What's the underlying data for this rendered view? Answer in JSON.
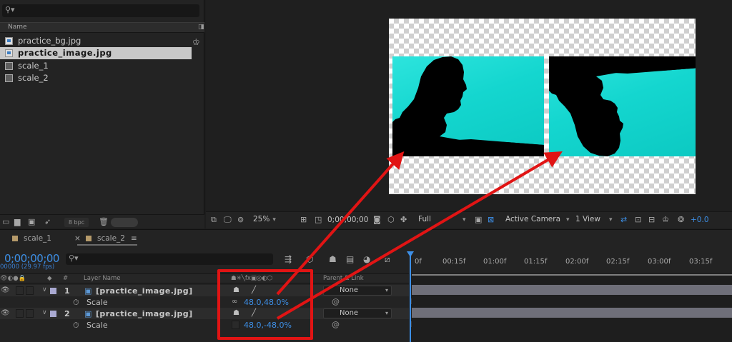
{
  "project": {
    "search_icon": "search-icon",
    "column_name": "Name",
    "items": [
      {
        "name": "practice_bg.jpg",
        "type": "image",
        "selected": false
      },
      {
        "name": "practice_image.jpg",
        "type": "image",
        "selected": true
      },
      {
        "name": "scale_1",
        "type": "composition",
        "selected": false
      },
      {
        "name": "scale_2",
        "type": "composition",
        "selected": false
      }
    ],
    "bit_depth": "8 bpc"
  },
  "viewer_toolbar": {
    "zoom": "25%",
    "timecode": "0;00;00;00",
    "resolution": "Full",
    "camera": "Active Camera",
    "views": "1 View",
    "exposure": "+0.0"
  },
  "timeline": {
    "tabs": [
      {
        "label": "scale_1",
        "active": false,
        "closable": false
      },
      {
        "label": "scale_2",
        "active": true,
        "closable": true
      }
    ],
    "current_time": "0;00;00;00",
    "fps": "00000 (29.97 fps)",
    "columns": {
      "number": "#",
      "layer_name": "Layer Name",
      "parent_link": "Parent & Link"
    },
    "layers": [
      {
        "index": "1",
        "name": "[practice_image.jpg]",
        "parent": "None",
        "property": "Scale",
        "value": "48.0,48.0%",
        "constrained": true
      },
      {
        "index": "2",
        "name": "[practice_image.jpg]",
        "parent": "None",
        "property": "Scale",
        "value": "48.0,-48.0%",
        "constrained": false
      }
    ],
    "ruler_labels": [
      "0f",
      "00:15f",
      "01:00f",
      "01:15f",
      "02:00f",
      "02:15f",
      "03:00f",
      "03:15f"
    ]
  },
  "colors": {
    "accent": "#3d8fe6",
    "annotation": "#e11414",
    "layer_label": "#a9a9d1",
    "footage": "#1ad8d1"
  }
}
